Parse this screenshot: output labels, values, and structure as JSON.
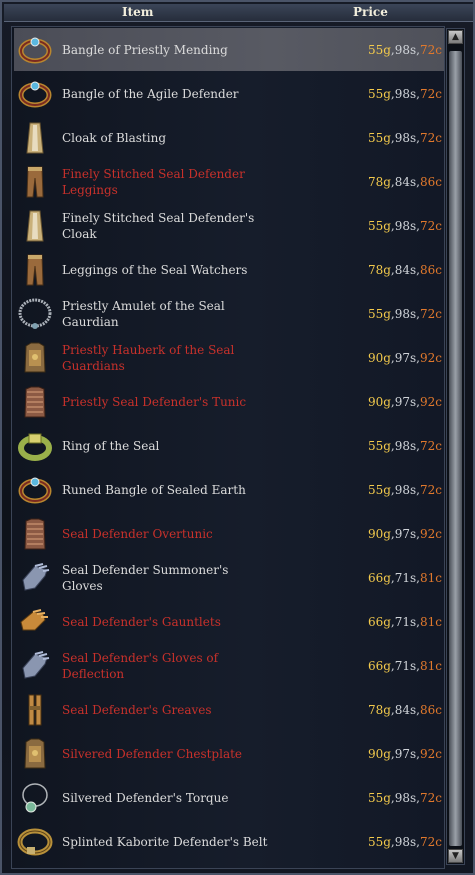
{
  "columns": {
    "item": "Item",
    "price": "Price"
  },
  "scrollbar": {
    "up": "▲",
    "down": "▼"
  },
  "items": [
    {
      "name": "Bangle of Priestly Mending",
      "red": false,
      "icon": "bracelet-icon",
      "g": "55g",
      "s": "98s",
      "c": "72c"
    },
    {
      "name": "Bangle of the Agile Defender",
      "red": false,
      "icon": "bracelet-icon",
      "g": "55g",
      "s": "98s",
      "c": "72c"
    },
    {
      "name": "Cloak of Blasting",
      "red": false,
      "icon": "cloak-icon",
      "g": "55g",
      "s": "98s",
      "c": "72c"
    },
    {
      "name": "Finely Stitched Seal Defender Leggings",
      "red": true,
      "icon": "leggings-icon",
      "g": "78g",
      "s": "84s",
      "c": "86c"
    },
    {
      "name": "Finely Stitched Seal Defender's Cloak",
      "red": false,
      "icon": "cloak-icon",
      "g": "55g",
      "s": "98s",
      "c": "72c"
    },
    {
      "name": "Leggings of the Seal Watchers",
      "red": false,
      "icon": "leggings-icon",
      "g": "78g",
      "s": "84s",
      "c": "86c"
    },
    {
      "name": "Priestly Amulet of the Seal Gaurdian",
      "red": false,
      "icon": "amulet-icon",
      "g": "55g",
      "s": "98s",
      "c": "72c"
    },
    {
      "name": "Priestly Hauberk of the Seal Guardians",
      "red": true,
      "icon": "chestplate-icon",
      "g": "90g",
      "s": "97s",
      "c": "92c"
    },
    {
      "name": "Priestly Seal Defender's Tunic",
      "red": true,
      "icon": "tunic-icon",
      "g": "90g",
      "s": "97s",
      "c": "92c"
    },
    {
      "name": "Ring of the Seal",
      "red": false,
      "icon": "ring-icon",
      "g": "55g",
      "s": "98s",
      "c": "72c"
    },
    {
      "name": "Runed Bangle of Sealed Earth",
      "red": false,
      "icon": "bracelet-icon",
      "g": "55g",
      "s": "98s",
      "c": "72c"
    },
    {
      "name": "Seal Defender Overtunic",
      "red": true,
      "icon": "tunic-icon",
      "g": "90g",
      "s": "97s",
      "c": "92c"
    },
    {
      "name": "Seal Defender Summoner's Gloves",
      "red": false,
      "icon": "gloves-icon",
      "g": "66g",
      "s": "71s",
      "c": "81c"
    },
    {
      "name": "Seal Defender's Gauntlets",
      "red": true,
      "icon": "gauntlets-icon",
      "g": "66g",
      "s": "71s",
      "c": "81c"
    },
    {
      "name": "Seal Defender's Gloves of Deflection",
      "red": true,
      "icon": "gloves-icon",
      "g": "66g",
      "s": "71s",
      "c": "81c"
    },
    {
      "name": "Seal Defender's Greaves",
      "red": true,
      "icon": "greaves-icon",
      "g": "78g",
      "s": "84s",
      "c": "86c"
    },
    {
      "name": "Silvered Defender Chestplate",
      "red": true,
      "icon": "chestplate-icon",
      "g": "90g",
      "s": "97s",
      "c": "92c"
    },
    {
      "name": "Silvered Defender's Torque",
      "red": false,
      "icon": "necklace-icon",
      "g": "55g",
      "s": "98s",
      "c": "72c"
    },
    {
      "name": "Splinted Kaborite Defender's Belt",
      "red": false,
      "icon": "belt-icon",
      "g": "55g",
      "s": "98s",
      "c": "72c"
    }
  ],
  "selected_index": 0
}
